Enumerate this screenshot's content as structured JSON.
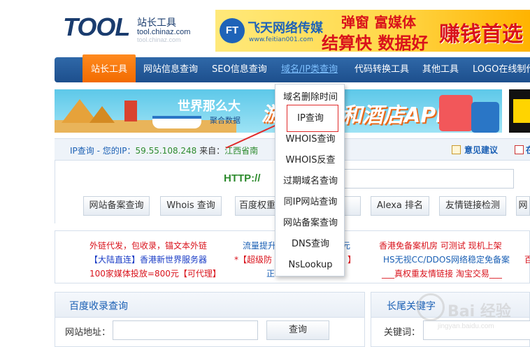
{
  "logo": {
    "main": "TOOL",
    "cn": "站长工具",
    "url": "tool.chinaz.com",
    "url_faded": "tool.chinaz.com"
  },
  "top_ad": {
    "mark": "FT",
    "brand": "飞天网络传媒",
    "site": "www.feitian001.com",
    "slogan1": "弹窗 富媒体",
    "slogan2": "结算快 数据好",
    "slogan3": "赚钱首选"
  },
  "nav": {
    "items": [
      {
        "label": "站长工具"
      },
      {
        "label": "网站信息查询"
      },
      {
        "label": "SEO信息查询"
      },
      {
        "label": "域名/IP类查询"
      },
      {
        "label": "代码转换工具"
      },
      {
        "label": "其他工具"
      },
      {
        "label": "LOGO在线制作"
      }
    ]
  },
  "banner": {
    "title": "世界那么大",
    "sub": "聚合数据",
    "left_text": "游",
    "api_text": "和酒店API"
  },
  "dropdown": {
    "items": [
      "域名删除时间",
      "IP查询",
      "WHOIS查询",
      "WHOIS反查",
      "过期域名查询",
      "同IP网站查询",
      "网站备案查询",
      "DNS查询",
      "NsLookup"
    ],
    "selected": "IP查询"
  },
  "ipbar": {
    "prefix": "IP查询 - 您的IP：",
    "ip": "59.55.108.248",
    "from": " 来自：",
    "location": "江西省南"
  },
  "header_links": {
    "suggest": "意见建议",
    "cal": "在"
  },
  "search": {
    "http_label": "HTTP://",
    "input_value": ""
  },
  "quick_buttons": [
    "网站备案查询",
    "Whois 查询",
    "百度权重",
    "",
    "Alexa 排名",
    "友情链接检测",
    "网"
  ],
  "ads": {
    "col1": [
      "外链代发，包收录，锚文本外链",
      "【大陆直连】香港新世界服务器",
      "100家媒体投放=800元【可代理】"
    ],
    "col2": [
      "流量提升",
      "*【超级防",
      "正"
    ],
    "col3": [
      "",
      "",
      ""
    ],
    "col4": [
      "香港免备案机房 可测试 现机上架",
      "HS无视CC/DDOS网络稳定免备案",
      "___真权重友情链接 淘宝交易___"
    ],
    "col5": [
      "",
      "百",
      ""
    ],
    "frag": [
      "元",
      "】"
    ]
  },
  "baidu_box": {
    "title": "百度收录查询",
    "label": "网站地址：",
    "button": "查询"
  },
  "longtail_box": {
    "title": "长尾关键字",
    "label": "关键词："
  },
  "watermark": {
    "text": "Bai 经验",
    "url": "jingyan.baidu.com"
  }
}
